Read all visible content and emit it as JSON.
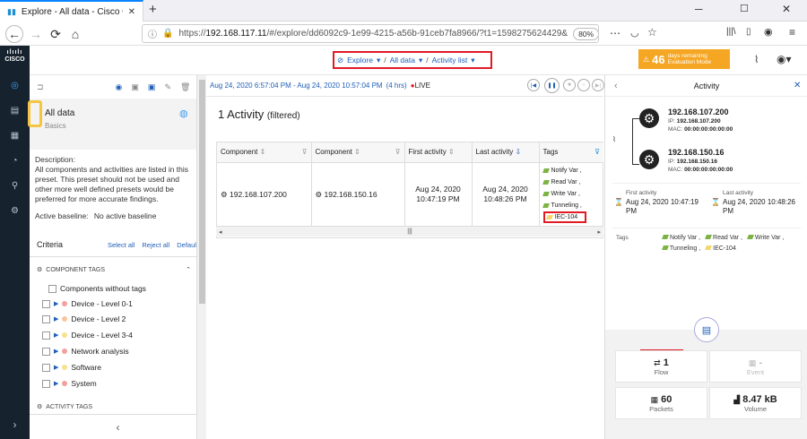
{
  "browser": {
    "tab_title": "Explore - All data - Cisco Cyber",
    "url_prefix": "https://",
    "url_host": "192.168.117.11",
    "url_rest": "/#/explore/dd6092c9-1e99-4215-a56b-91ceb7fa8966/?t1=1598275624429&",
    "zoom": "80%"
  },
  "app": {
    "brand": "CISCO",
    "crumbs": {
      "explore": "Explore",
      "alldata": "All data",
      "activity": "Activity list"
    },
    "eval": {
      "days": "46",
      "line1": "days remaining",
      "line2": "Evaluation Mode"
    }
  },
  "left": {
    "preset_title": "All data",
    "preset_sub": "Basics",
    "desc_label": "Description:",
    "desc": "All components and activities are listed in this preset. This preset should not be used and other more well defined presets would be preferred for more accurate findings.",
    "baseline_label": "Active baseline:",
    "baseline_value": "No active baseline",
    "criteria": "Criteria",
    "select_all": "Select all",
    "reject_all": "Reject all",
    "default": "Default",
    "section1": "COMPONENT TAGS",
    "section2": "ACTIVITY TAGS",
    "tree": [
      {
        "label": "Components without tags"
      },
      {
        "label": "Device - Level 0-1",
        "color": "#f2a0a0"
      },
      {
        "label": "Device - Level 2",
        "color": "#f7c59f"
      },
      {
        "label": "Device - Level 3-4",
        "color": "#f7e08f"
      },
      {
        "label": "Network analysis",
        "color": "#f2a0a0"
      },
      {
        "label": "Software",
        "color": "#f7e08f"
      },
      {
        "label": "System",
        "color": "#f2a0a0"
      }
    ]
  },
  "main": {
    "timerange": "Aug 24, 2020 6:57:04 PM - Aug 24, 2020 10:57:04 PM",
    "hours": "(4 hrs)",
    "live": "LIVE",
    "count": "1 Activity",
    "filtered": "(filtered)",
    "columns": [
      "Component",
      "Component",
      "First activity",
      "Last activity",
      "Tags"
    ],
    "row": {
      "c1": "192.168.107.200",
      "c2": "192.168.150.16",
      "first1": "Aug 24, 2020",
      "first2": "10:47:19 PM",
      "last1": "Aug 24, 2020",
      "last2": "10:48:26 PM",
      "tags": [
        {
          "label": "Notify Var ,",
          "color": "#7cb342"
        },
        {
          "label": "Read Var ,",
          "color": "#7cb342"
        },
        {
          "label": "Write Var ,",
          "color": "#7cb342"
        },
        {
          "label": "Tunneling ,",
          "color": "#7cb342"
        },
        {
          "label": "IEC-104",
          "color": "#f5d76e"
        }
      ]
    }
  },
  "right": {
    "title": "Activity",
    "a_ip": "192.168.107.200",
    "a_iplabel": "IP:",
    "a_ipval": "192.168.107.200",
    "a_mac": "MAC:",
    "a_macval": "00:00:00:00:00:00",
    "b_ip": "192.168.150.16",
    "b_iplabel": "IP:",
    "b_ipval": "192.168.150.16",
    "b_mac": "MAC:",
    "b_macval": "00:00:00:00:00:00",
    "first_label": "First activity",
    "first_val": "Aug 24, 2020 10:47:19 PM",
    "last_label": "Last activity",
    "last_val": "Aug 24, 2020 10:48:26 PM",
    "tags_label": "Tags",
    "tags_line1": [
      "Notify Var ,",
      "Read Var ,",
      "Write Var ,"
    ],
    "tags_line2": [
      "Tunneling ,",
      "IEC-104"
    ],
    "stats": {
      "flow_v": "1",
      "flow_l": "Flow",
      "event_v": "-",
      "event_l": "Event",
      "packets_v": "60",
      "packets_l": "Packets",
      "volume_v": "8.47 kB",
      "volume_l": "Volume"
    }
  }
}
